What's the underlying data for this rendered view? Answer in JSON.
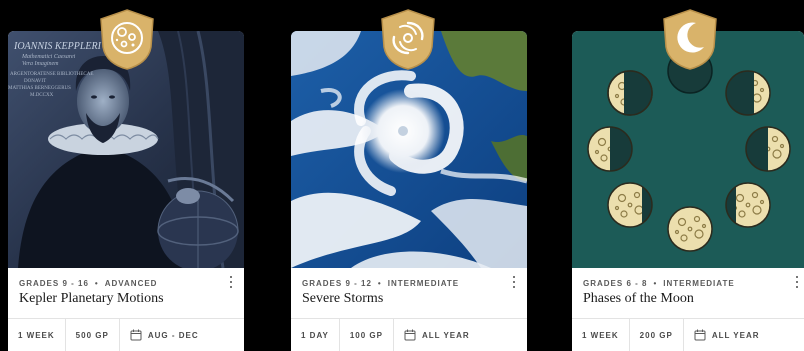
{
  "cards": [
    {
      "badge_icon": "planets-icon",
      "image_subject": "kepler-portrait",
      "grades": "GRADES 9 - 16",
      "level": "ADVANCED",
      "title": "Kepler Planetary Motions",
      "duration": "1 WEEK",
      "points": "500 GP",
      "season": "AUG - DEC",
      "portrait_caption": [
        "IOANNIS KEPPLERI",
        "Mathematici Caesarei",
        "Vera Imaginem",
        "ARGENTORATENSE BIBLIOTHECAE",
        "DONAVIT",
        "MATTHIAS BERNEGGERUS",
        "M.DCCXX"
      ]
    },
    {
      "badge_icon": "storm-icon",
      "image_subject": "hurricane-satellite",
      "grades": "GRADES 9 - 12",
      "level": "INTERMEDIATE",
      "title": "Severe Storms",
      "duration": "1 DAY",
      "points": "100 GP",
      "season": "ALL YEAR"
    },
    {
      "badge_icon": "crescent-moon-icon",
      "image_subject": "moon-phases",
      "grades": "GRADES 6 - 8",
      "level": "INTERMEDIATE",
      "title": "Phases of the Moon",
      "duration": "1 WEEK",
      "points": "200 GP",
      "season": "ALL YEAR"
    }
  ],
  "separator": "•",
  "colors": {
    "badge_gold": "#d9b36a",
    "badge_gold_dark": "#b8904a",
    "moon_bg": "#1c5b57",
    "moon_light": "#ecdfae",
    "moon_dark": "#173b3a",
    "kepler_tint": "#1c2b45"
  }
}
